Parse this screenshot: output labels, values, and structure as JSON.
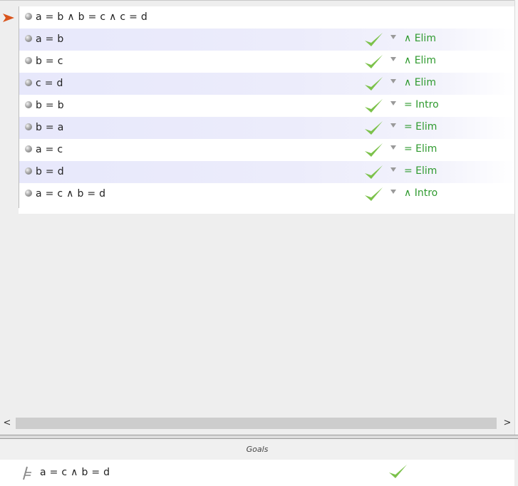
{
  "proof": {
    "premise": "a = b ∧ b = c ∧ c = d",
    "steps": [
      {
        "formula": "a = b",
        "rule": "∧ Elim"
      },
      {
        "formula": "b = c",
        "rule": "∧ Elim"
      },
      {
        "formula": "c = d",
        "rule": "∧ Elim"
      },
      {
        "formula": "b = b",
        "rule": "= Intro"
      },
      {
        "formula": "b = a",
        "rule": "= Elim"
      },
      {
        "formula": "a = c",
        "rule": "= Elim"
      },
      {
        "formula": "b = d",
        "rule": "= Elim"
      },
      {
        "formula": "a = c ∧ b = d",
        "rule": "∧ Intro"
      }
    ]
  },
  "scrollbar": {
    "left_arrow": "<",
    "right_arrow": ">"
  },
  "goals": {
    "header": "Goals",
    "items": [
      {
        "formula": "a = c ∧ b = d"
      }
    ]
  },
  "icons": {
    "current_line": "current-line-arrow-icon",
    "bullet": "line-bullet-icon",
    "valid": "checkmark-icon",
    "rule_menu": "dropdown-triangle-icon",
    "goal": "turnstile-icon"
  },
  "colors": {
    "check": "#7cc24b",
    "rule_text": "#2f9a2f",
    "arrow": "#d9541c",
    "alt_row": "#e7e8fb"
  }
}
